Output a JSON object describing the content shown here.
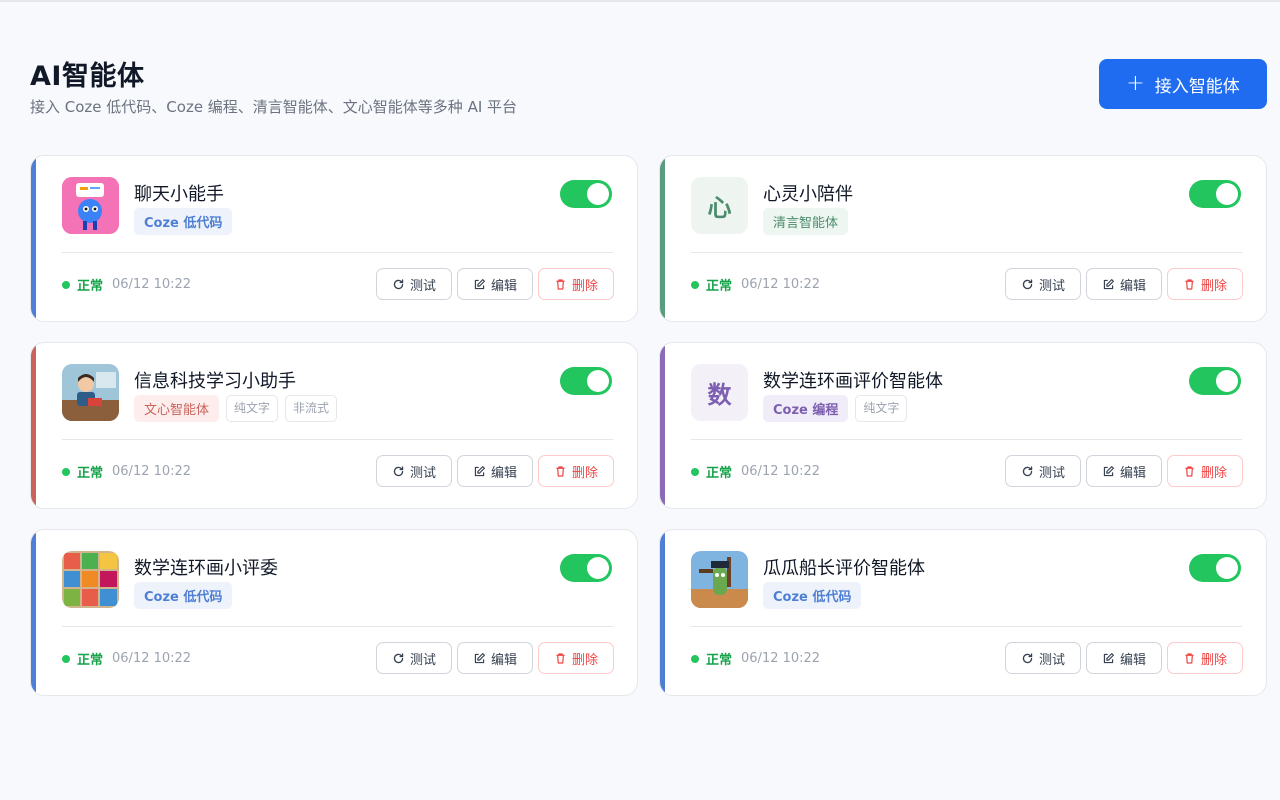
{
  "header": {
    "title": "AI智能体",
    "subtitle": "接入 Coze 低代码、Coze 编程、清言智能体、文心智能体等多种 AI 平台",
    "add_button": "接入智能体"
  },
  "colors": {
    "primary": "#1f6cf0",
    "status_green": "#22c55e",
    "delete_red": "#ef4444"
  },
  "agents": [
    {
      "name": "聊天小能手",
      "avatar_icon": "robot-chat-icon",
      "tags": [
        "Coze 低代码"
      ],
      "status": "正常",
      "time": "06/12 10:22",
      "enabled": true
    },
    {
      "name": "心灵小陪伴",
      "avatar_text": "心",
      "tags": [
        "清言智能体"
      ],
      "status": "正常",
      "time": "06/12 10:22",
      "enabled": true
    },
    {
      "name": "信息科技学习小助手",
      "avatar_icon": "student-illustration-icon",
      "tags": [
        "文心智能体",
        "纯文字",
        "非流式"
      ],
      "status": "正常",
      "time": "06/12 10:22",
      "enabled": true
    },
    {
      "name": "数学连环画评价智能体",
      "avatar_text": "数",
      "tags": [
        "Coze 编程",
        "纯文字"
      ],
      "status": "正常",
      "time": "06/12 10:22",
      "enabled": true
    },
    {
      "name": "数学连环画小评委",
      "avatar_icon": "comic-grid-icon",
      "tags": [
        "Coze 低代码"
      ],
      "status": "正常",
      "time": "06/12 10:22",
      "enabled": true
    },
    {
      "name": "瓜瓜船长评价智能体",
      "avatar_icon": "captain-illustration-icon",
      "tags": [
        "Coze 低代码"
      ],
      "status": "正常",
      "time": "06/12 10:22",
      "enabled": true
    }
  ],
  "actions": {
    "test": "测试",
    "edit": "编辑",
    "delete": "删除"
  }
}
